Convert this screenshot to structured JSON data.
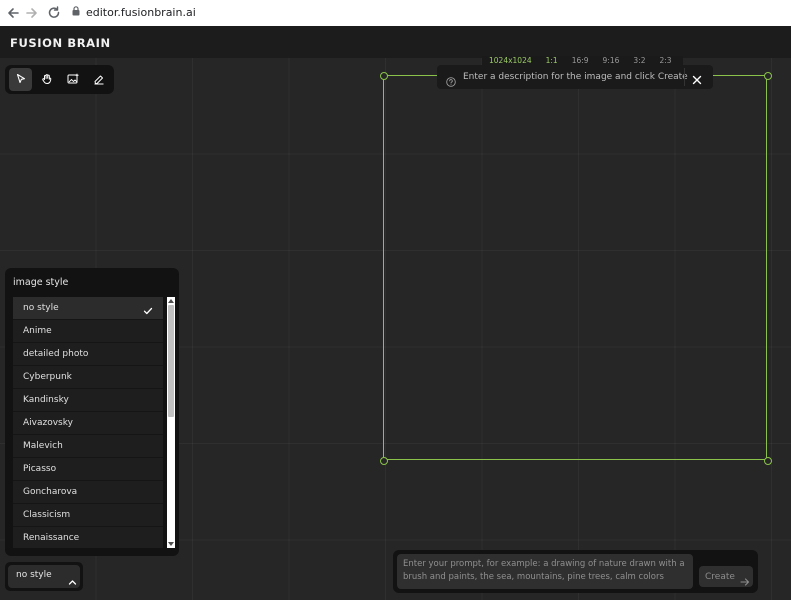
{
  "browser": {
    "url": "editor.fusionbrain.ai"
  },
  "app": {
    "brand": "FUSION BRAIN"
  },
  "tools": [
    {
      "name": "select-tool",
      "icon": "cursor-arrow-icon",
      "active": true
    },
    {
      "name": "hand-tool",
      "icon": "hand-icon",
      "active": false
    },
    {
      "name": "image-tool",
      "icon": "add-image-icon",
      "active": false
    },
    {
      "name": "eraser-tool",
      "icon": "eraser-icon",
      "active": false
    }
  ],
  "ratios": {
    "resolution": "1024x1024",
    "options": [
      "1:1",
      "16:9",
      "9:16",
      "3:2",
      "2:3"
    ],
    "selected": "1:1"
  },
  "tip": {
    "text": "Enter a description for the image and click Create",
    "close_icon": "close-icon"
  },
  "style_panel": {
    "title": "image style",
    "items": [
      {
        "label": "no style",
        "selected": true
      },
      {
        "label": "Anime",
        "selected": false
      },
      {
        "label": "detailed photo",
        "selected": false
      },
      {
        "label": "Cyberpunk",
        "selected": false
      },
      {
        "label": "Kandinsky",
        "selected": false
      },
      {
        "label": "Aivazovsky",
        "selected": false
      },
      {
        "label": "Malevich",
        "selected": false
      },
      {
        "label": "Picasso",
        "selected": false
      },
      {
        "label": "Goncharova",
        "selected": false
      },
      {
        "label": "Classicism",
        "selected": false
      },
      {
        "label": "Renaissance",
        "selected": false
      }
    ]
  },
  "style_selector": {
    "label": "no style"
  },
  "prompt": {
    "placeholder": "Enter your prompt, for example: a drawing of nature drawn with a\nbrush and paints, the sea, mountains, pine trees, calm colors",
    "create_label": "Create"
  },
  "colors": {
    "accent": "#8bc34a",
    "background": "#262626",
    "panel": "#121212"
  }
}
